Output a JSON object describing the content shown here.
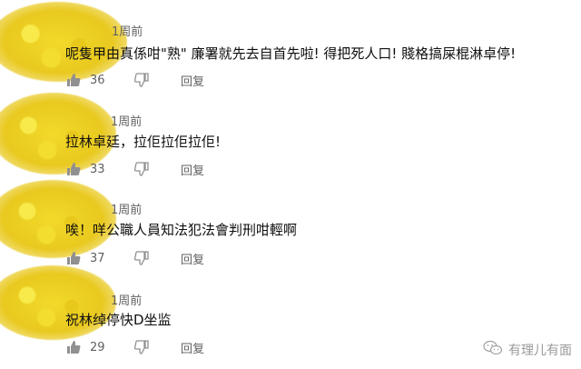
{
  "comments": [
    {
      "time": "1周前",
      "text": "呢隻甲由真係咁\"熟\" 廉署就先去自首先啦! 得把死人口! 賤格搞屎棍淋卓停!",
      "likes": "36",
      "reply_label": "回复"
    },
    {
      "time": "1周前",
      "text": "拉林卓廷，拉佢拉佢拉佢!",
      "likes": "33",
      "reply_label": "回复"
    },
    {
      "time": "1周前",
      "text": "唉！咩公職人員知法犯法會判刑咁輕啊",
      "likes": "37",
      "reply_label": "回复"
    },
    {
      "time": "1周前",
      "text": "祝林绰停快D坐监",
      "likes": "29",
      "reply_label": "回复"
    }
  ],
  "icons": {
    "like": "thumbs-up-icon",
    "dislike": "thumbs-down-icon",
    "watermark": "wechat-icon"
  },
  "watermark": {
    "text": "有理儿有面"
  },
  "colors": {
    "avatar_blur": "#f2da2a",
    "meta_text": "#606060",
    "icon": "#909090"
  }
}
